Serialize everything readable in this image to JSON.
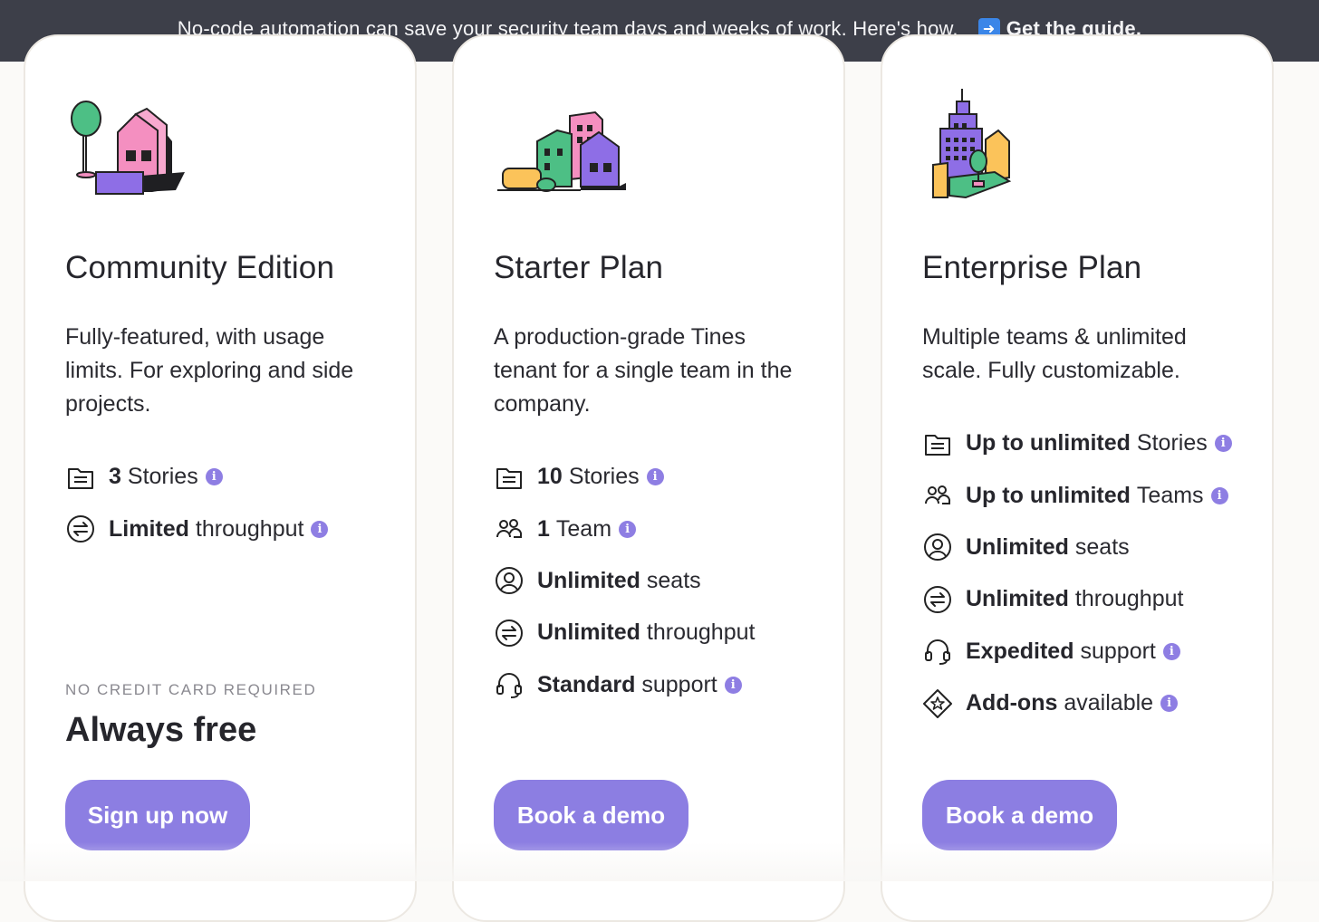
{
  "banner": {
    "message": "No-code automation can save your security team days and weeks of work. Here's how.",
    "cta_label": "Get the guide.",
    "cta_icon": "right-arrow-icon"
  },
  "colors": {
    "banner_bg": "#3d3f49",
    "accent": "#8c7ee2",
    "info_dot": "#8e7ee3",
    "card_border": "#ece8e2"
  },
  "plans": [
    {
      "title": "Community Edition",
      "description": "Fully-featured, with usage limits. For exploring and side projects.",
      "illustration": "house-tree-illustration",
      "features": [
        {
          "icon": "stories-icon",
          "bold": "3",
          "text": "Stories",
          "info": true
        },
        {
          "icon": "throughput-icon",
          "bold": "Limited",
          "text": "throughput",
          "info": true
        }
      ],
      "note": "NO CREDIT CARD REQUIRED",
      "price": "Always free",
      "button": "Sign up now"
    },
    {
      "title": "Starter Plan",
      "description": "A production-grade Tines tenant for a single team in the company.",
      "illustration": "neighborhood-illustration",
      "features": [
        {
          "icon": "stories-icon",
          "bold": "10",
          "text": "Stories",
          "info": true
        },
        {
          "icon": "team-icon",
          "bold": "1",
          "text": "Team",
          "info": true
        },
        {
          "icon": "seat-icon",
          "bold": "Unlimited",
          "text": "seats",
          "info": false
        },
        {
          "icon": "throughput-icon",
          "bold": "Unlimited",
          "text": "throughput",
          "info": false
        },
        {
          "icon": "headset-icon",
          "bold": "Standard",
          "text": "support",
          "info": true
        }
      ],
      "button": "Book a demo"
    },
    {
      "title": "Enterprise Plan",
      "description": "Multiple teams & unlimited scale. Fully customizable.",
      "illustration": "city-illustration",
      "features": [
        {
          "icon": "stories-icon",
          "bold": "Up to unlimited",
          "text": "Stories",
          "info": true
        },
        {
          "icon": "team-icon",
          "bold": "Up to unlimited",
          "text": "Teams",
          "info": true
        },
        {
          "icon": "seat-icon",
          "bold": "Unlimited",
          "text": "seats",
          "info": false
        },
        {
          "icon": "throughput-icon",
          "bold": "Unlimited",
          "text": "throughput",
          "info": false
        },
        {
          "icon": "headset-icon",
          "bold": "Expedited",
          "text": "support",
          "info": true
        },
        {
          "icon": "addons-icon",
          "bold": "Add-ons",
          "text": "available",
          "info": true
        }
      ],
      "button": "Book a demo"
    }
  ]
}
